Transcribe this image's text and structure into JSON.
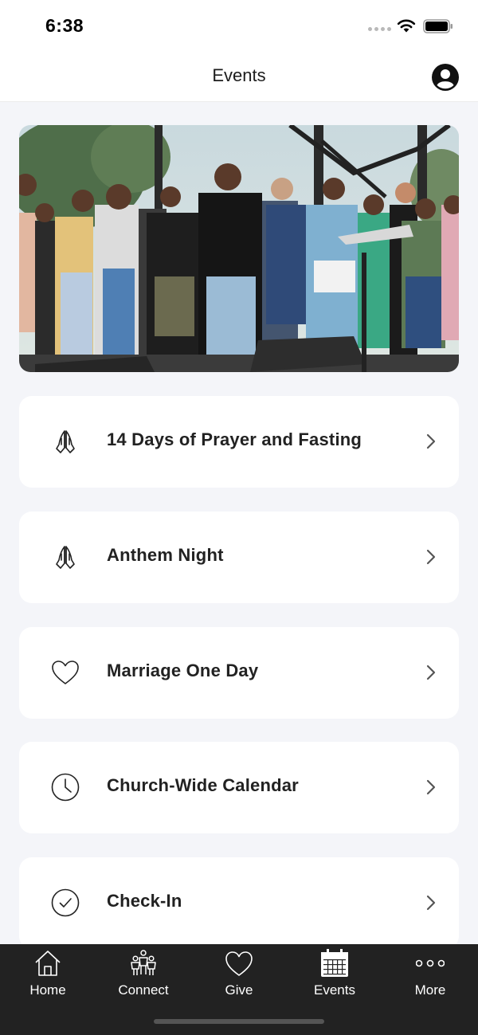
{
  "status_bar": {
    "time": "6:38"
  },
  "header": {
    "title": "Events"
  },
  "events": [
    {
      "label": "14 Days of Prayer and Fasting",
      "icon": "praying-hands-icon"
    },
    {
      "label": "Anthem Night",
      "icon": "praying-hands-icon"
    },
    {
      "label": "Marriage One Day",
      "icon": "heart-icon"
    },
    {
      "label": "Church-Wide Calendar",
      "icon": "clock-icon"
    },
    {
      "label": "Check-In",
      "icon": "check-circle-icon"
    }
  ],
  "tabs": [
    {
      "label": "Home",
      "icon": "home-icon"
    },
    {
      "label": "Connect",
      "icon": "people-icon"
    },
    {
      "label": "Give",
      "icon": "heart-icon"
    },
    {
      "label": "Events",
      "icon": "calendar-icon",
      "active": true
    },
    {
      "label": "More",
      "icon": "more-dots-icon"
    }
  ],
  "colors": {
    "background": "#f4f5f9",
    "card": "#ffffff",
    "tab_bar": "#222222",
    "text": "#222222"
  }
}
